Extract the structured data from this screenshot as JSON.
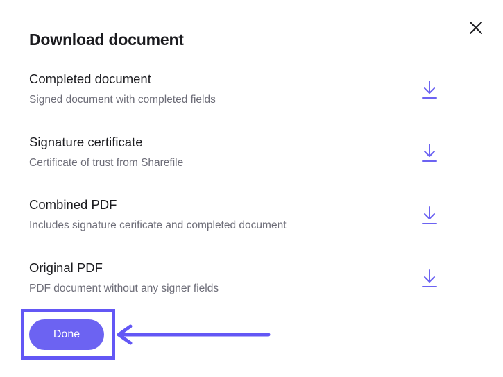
{
  "dialog": {
    "title": "Download document",
    "close_icon": "close-icon",
    "accent_color": "#6c63f2",
    "items": [
      {
        "title": "Completed document",
        "description": "Signed document with completed fields",
        "icon": "download-icon"
      },
      {
        "title": "Signature certificate",
        "description": "Certificate of trust from Sharefile",
        "icon": "download-icon"
      },
      {
        "title": "Combined PDF",
        "description": "Includes signature cerificate and completed document",
        "icon": "download-icon"
      },
      {
        "title": "Original PDF",
        "description": "PDF document without any signer fields",
        "icon": "download-icon"
      }
    ],
    "done_label": "Done"
  },
  "annotation": {
    "highlight_color": "#6357f5",
    "arrow_icon": "arrow-left-icon"
  }
}
